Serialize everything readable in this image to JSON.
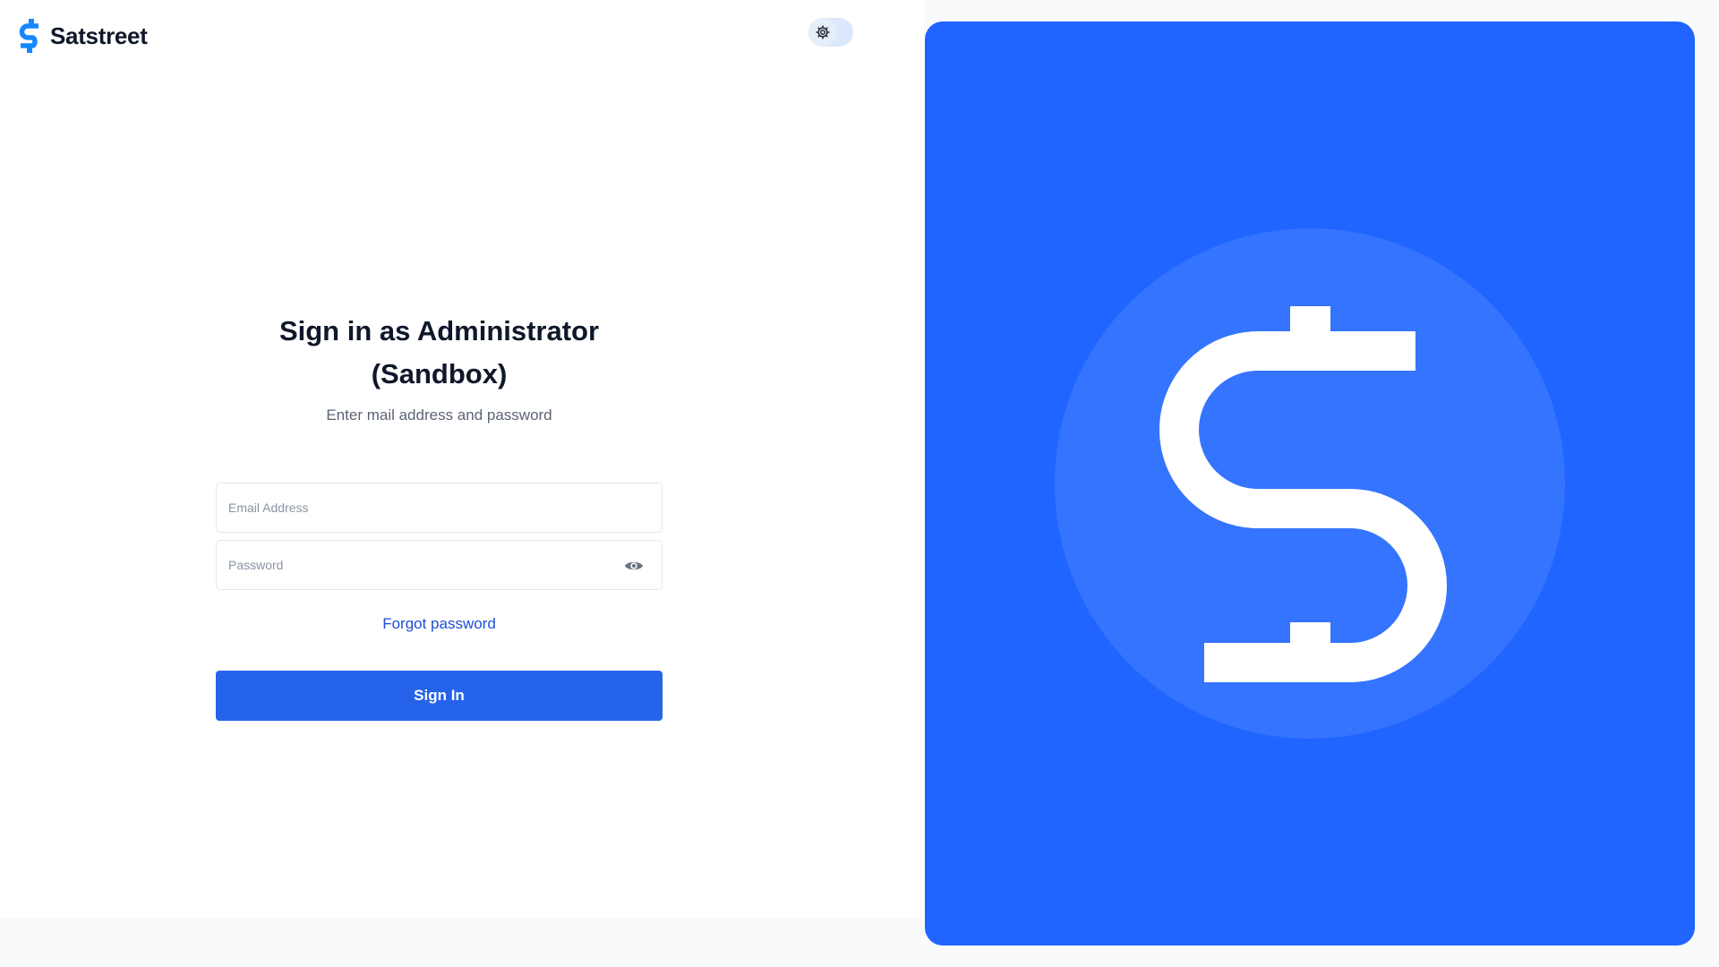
{
  "brand": {
    "name": "Satstreet",
    "logo_icon": "dollar-s-icon",
    "logo_color": "#1687ff"
  },
  "theme_toggle": {
    "icon": "gear-icon"
  },
  "login": {
    "title": "Sign in as Administrator (Sandbox)",
    "subtitle": "Enter mail address and password",
    "email_placeholder": "Email Address",
    "email_value": "",
    "password_placeholder": "Password",
    "password_value": "",
    "password_toggle_icon": "eye-icon",
    "forgot_label": "Forgot password",
    "submit_label": "Sign In"
  },
  "panel": {
    "background": "#2065ff",
    "circle_color": "#3474ff",
    "logo_icon": "dollar-s-icon"
  },
  "colors": {
    "primary": "#2563eb",
    "link": "#1d4ed8",
    "title": "#0f172a"
  }
}
